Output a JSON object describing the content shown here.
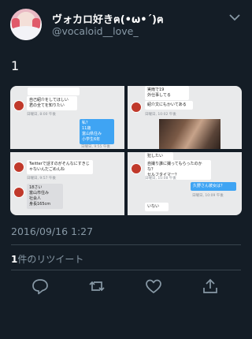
{
  "user": {
    "display_name": "ヴォカロ好きฅ(•ω•´)ฅ",
    "handle": "@vocaloid__love_"
  },
  "tweet": {
    "text": "1",
    "date": "2016/09/16 1:27",
    "retweet_count": "1",
    "retweet_label": "件のリツイート"
  },
  "media": {
    "top_left": {
      "bubble1": "自己紹介をしてほしい\n君の全てを知りたい",
      "meta1": "日曜日, 8:00 午後",
      "blue_bubble": "私？\n11歳\n富山県住み\n小学生6年",
      "meta2": "日曜日, 9:55 午後"
    },
    "top_right": {
      "bubble1": "実雨で19\n外仕事してる",
      "bubble2": "紹介文にもかいてある",
      "meta1": "日曜日, 10:02 午後"
    },
    "bottom_left": {
      "bubble1": "Twitterで話すのがそんなにすきじゃないんだごめんね",
      "meta1": "日曜日, 9:57 午後",
      "bubble2": "18さい\n富山市住み\n社会人\n身長165cm"
    },
    "bottom_right": {
      "bubble0": "犯したい",
      "bubble1": "自撮り誰に撮ってもらったのかな？\nセルフタイマー？",
      "meta1": "日曜日, 10:08 午後",
      "blue_bubble": "久野さん彼女は？",
      "meta2": "日曜日, 10:09 午後",
      "bubble2": "いない"
    }
  },
  "icons": {
    "chevron": "chevron-down-icon",
    "reply": "reply-icon",
    "retweet": "retweet-icon",
    "like": "heart-icon",
    "share": "share-icon"
  },
  "colors": {
    "background": "#141d26",
    "secondary_text": "#8899a6",
    "divider": "#38444d"
  }
}
